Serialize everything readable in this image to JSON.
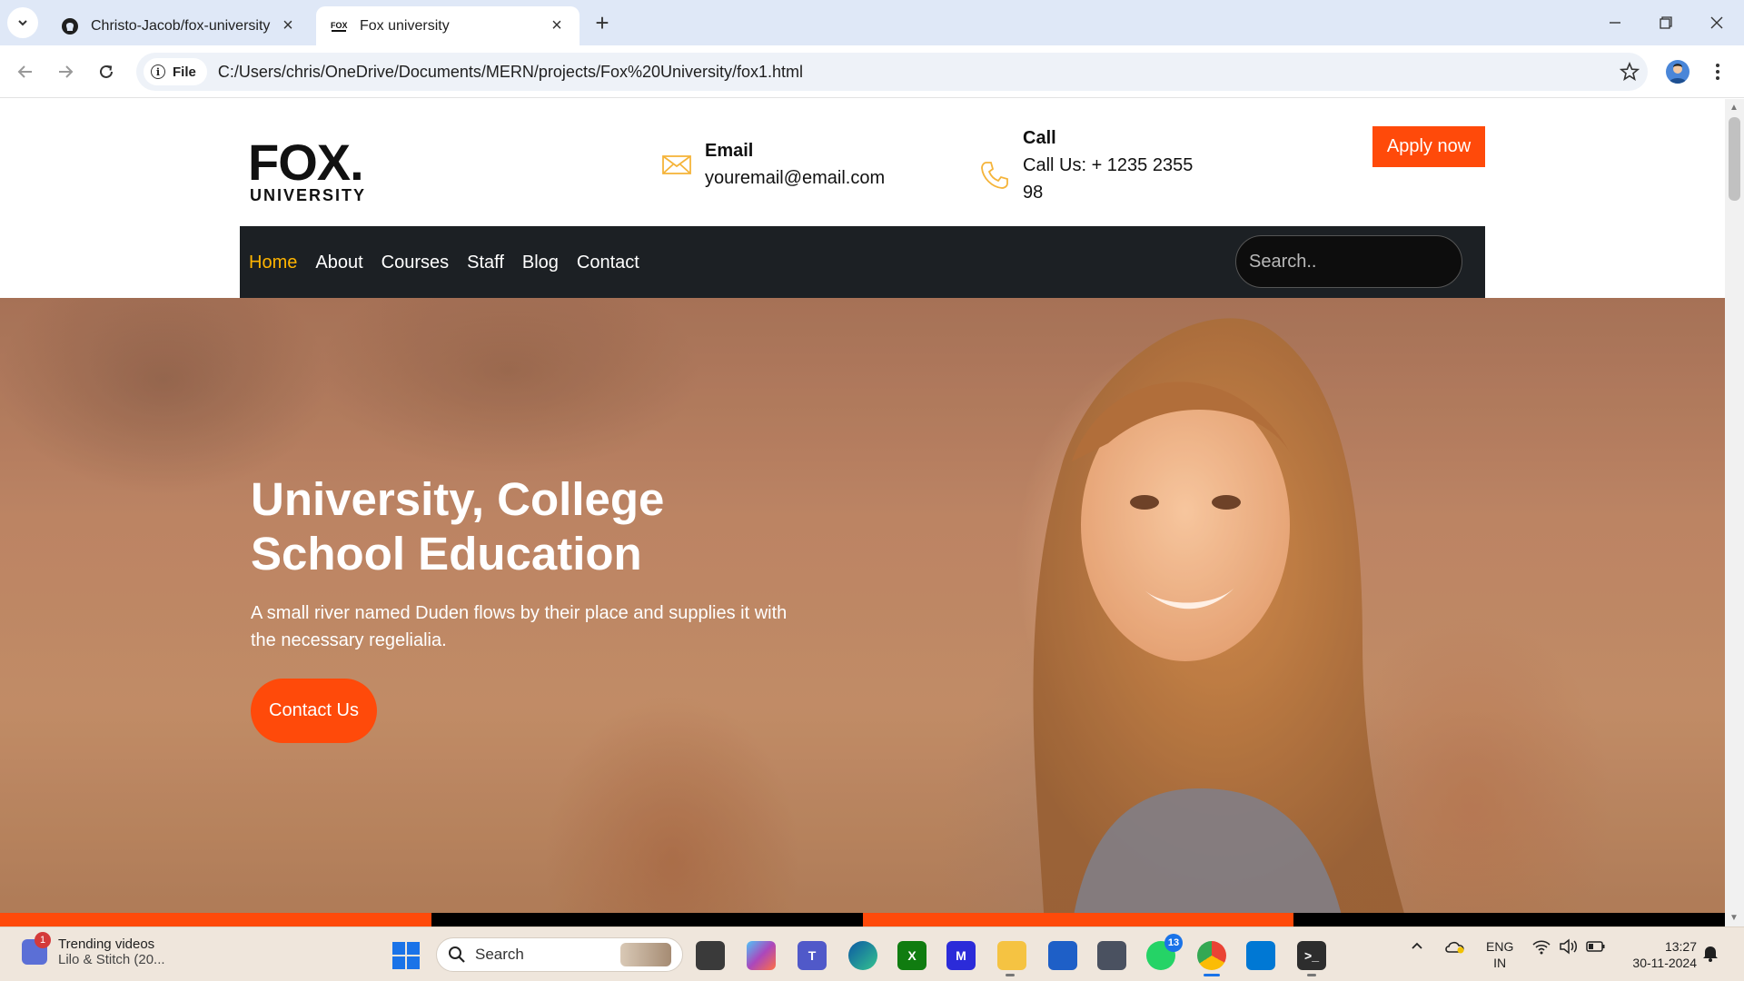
{
  "browser": {
    "tabs": [
      {
        "title": "Christo-Jacob/fox-university",
        "favicon": "github-icon"
      },
      {
        "title": "Fox university",
        "favicon": "fox-favicon-icon"
      }
    ],
    "site_chip": "File",
    "url": "C:/Users/chris/OneDrive/Documents/MERN/projects/Fox%20University/fox1.html"
  },
  "site": {
    "logo": {
      "main": "FOX.",
      "sub": "UNIVERSITY"
    },
    "email": {
      "label": "Email",
      "value": "youremail@email.com"
    },
    "call": {
      "label": "Call",
      "value": "Call Us: + 1235 2355 98"
    },
    "apply_label": "Apply now",
    "nav": [
      "Home",
      "About",
      "Courses",
      "Staff",
      "Blog",
      "Contact"
    ],
    "nav_active": "Home",
    "search_placeholder": "Search.."
  },
  "hero": {
    "title_line1": "University, College",
    "title_line2": "School Education",
    "text": "A small river named Duden flows by their place and supplies it with the necessary regelialia.",
    "button": "Contact Us"
  },
  "colors": {
    "accent": "#ff4a0a",
    "nav_bg": "#1c2024",
    "nav_active": "#ffb400",
    "icon_gold": "#f5b43a",
    "stripes": [
      "#ff4a0a",
      "#000000",
      "#ff4a0a",
      "#000000"
    ]
  },
  "taskbar": {
    "widget_title": "Trending videos",
    "widget_subtitle": "Lilo & Stitch (20...",
    "widget_badge": "1",
    "search_label": "Search",
    "whatsapp_badge": "13",
    "lang_line1": "ENG",
    "lang_line2": "IN",
    "time": "13:27",
    "date": "30-11-2024"
  }
}
